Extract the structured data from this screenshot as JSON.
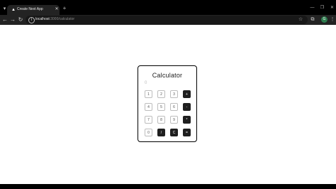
{
  "browser": {
    "tab": {
      "title": "Create Next App",
      "favicon": "nextjs-favicon-icon"
    },
    "url": {
      "host": "localhost",
      "path": ":3000/calculator"
    },
    "profile_initial": "G"
  },
  "calculator": {
    "title": "Calculator",
    "display": "0",
    "keys": [
      [
        "1",
        "2",
        "3",
        "+"
      ],
      [
        "4",
        "5",
        "6",
        "-"
      ],
      [
        "7",
        "8",
        "9",
        "*"
      ],
      [
        "0",
        "/",
        "C",
        "="
      ]
    ]
  },
  "colors": {
    "operator_key_bg": "#1f1f1f",
    "number_key_border": "#bdbdbd",
    "card_border": "#000000"
  }
}
